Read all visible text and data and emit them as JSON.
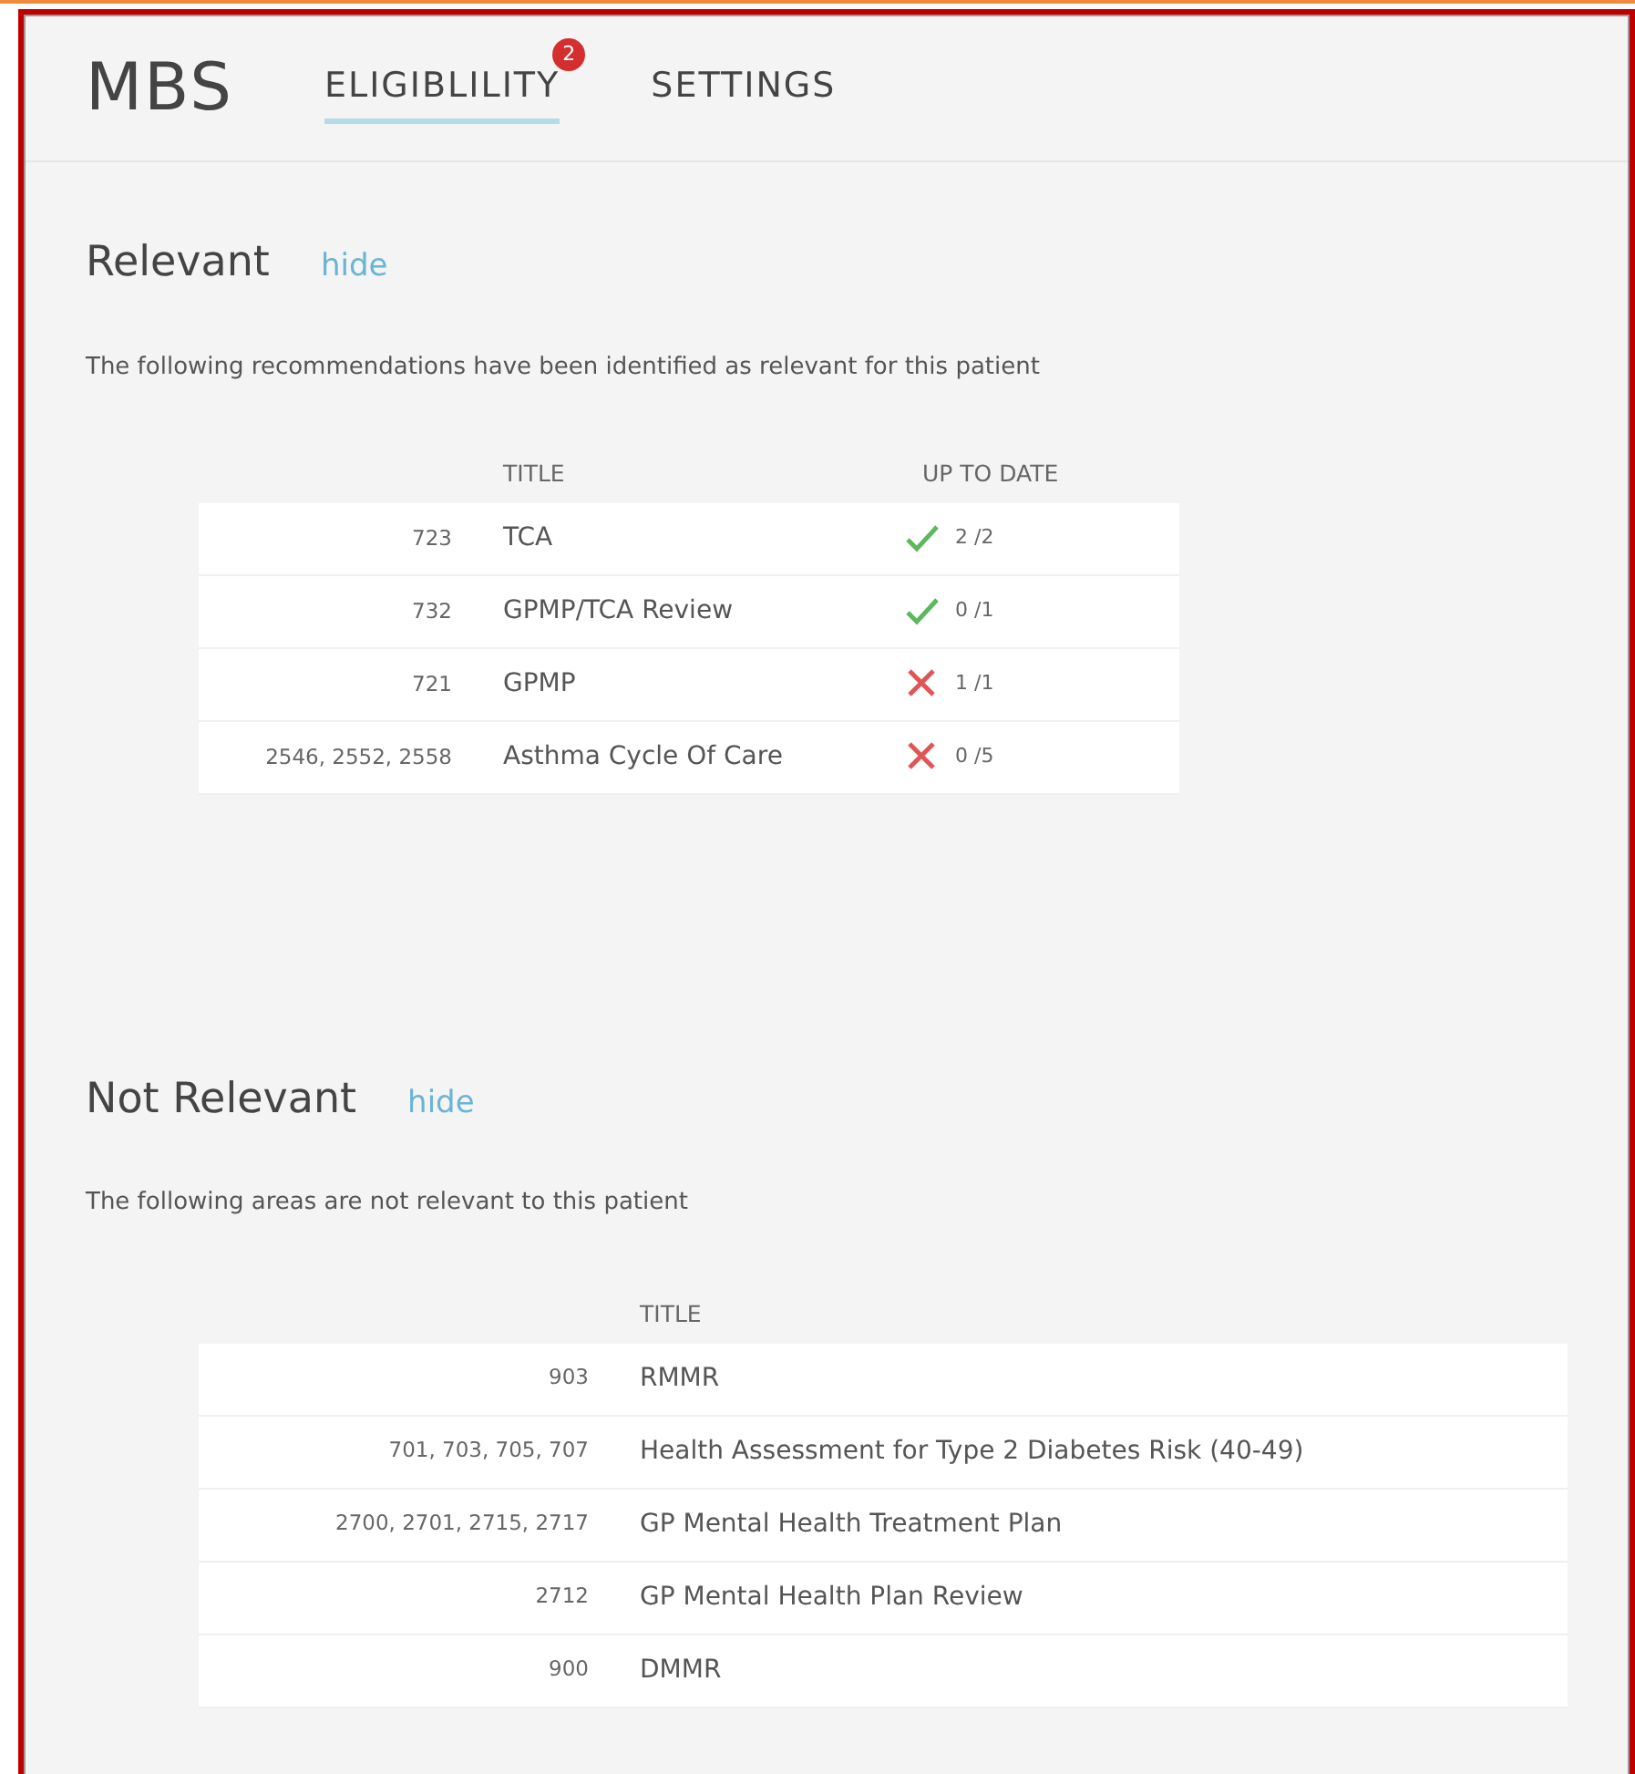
{
  "app": {
    "title": "MBS"
  },
  "tabs": [
    {
      "label": "ELIGIBLILITY",
      "selected": true,
      "badge": "2"
    },
    {
      "label": "SETTINGS",
      "selected": false
    }
  ],
  "relevant": {
    "heading": "Relevant",
    "toggle": "hide",
    "description": "The following recommendations have been identified as relevant for this patient",
    "columns": [
      "TITLE",
      "UP TO DATE"
    ],
    "rows": [
      {
        "codes": "723",
        "title": "TCA",
        "kind": "check",
        "count": "2 /2"
      },
      {
        "codes": "732",
        "title": "GPMP/TCA Review",
        "kind": "check",
        "count": "0 /1"
      },
      {
        "codes": "721",
        "title": "GPMP",
        "kind": "cross",
        "count": "1 /1"
      },
      {
        "codes": "2546, 2552, 2558",
        "title": "Asthma Cycle Of Care",
        "kind": "cross",
        "count": "0 /5"
      }
    ]
  },
  "not_relevant": {
    "heading": "Not Relevant",
    "toggle": "hide",
    "description": "The following areas are not relevant to this patient",
    "columns": [
      "TITLE"
    ],
    "rows": [
      {
        "codes": "903",
        "title": "RMMR"
      },
      {
        "codes": "701, 703, 705, 707",
        "title": "Health Assessment for Type 2 Diabetes Risk (40-49)"
      },
      {
        "codes": "2700, 2701, 2715, 2717",
        "title": "GP Mental Health Treatment Plan"
      },
      {
        "codes": "2712",
        "title": "GP Mental Health Plan Review"
      },
      {
        "codes": "900",
        "title": "DMMR"
      }
    ]
  }
}
